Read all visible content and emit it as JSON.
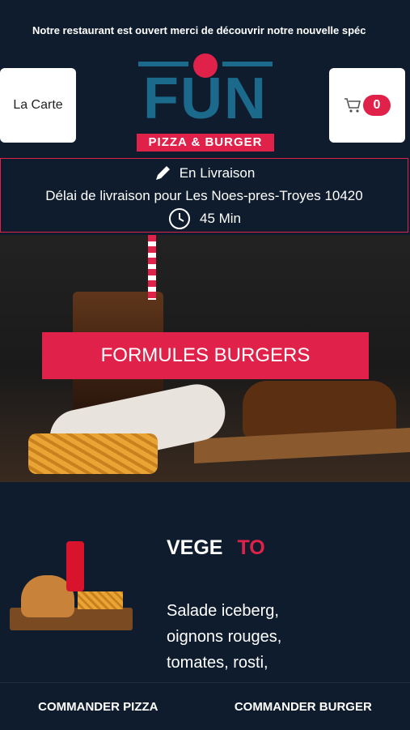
{
  "ticker": {
    "text": "Notre restaurant est ouvert merci de découvrir notre nouvelle spéc"
  },
  "header": {
    "menu_label": "La Carte",
    "cart_count": "0",
    "logo": {
      "main": "FUN",
      "sub": "PIZZA & BURGER"
    }
  },
  "delivery": {
    "mode": "En Livraison",
    "info": "Délai de livraison pour Les Noes-pres-Troyes 10420",
    "time": "45 Min"
  },
  "hero": {
    "title": "FORMULES BURGERS"
  },
  "product": {
    "name": "VEGE",
    "accent": "TO",
    "description_lines": [
      "Salade iceberg,",
      "oignons rouges,",
      "tomates, rosti,"
    ]
  },
  "footer": {
    "pizza": "COMMANDER PIZZA",
    "burger": "COMMANDER BURGER"
  },
  "colors": {
    "accent": "#e0224a",
    "background": "#0f1c2e",
    "logo_blue": "#1b6a8c"
  },
  "icons": [
    "cart-icon",
    "pencil-icon",
    "clock-icon"
  ]
}
